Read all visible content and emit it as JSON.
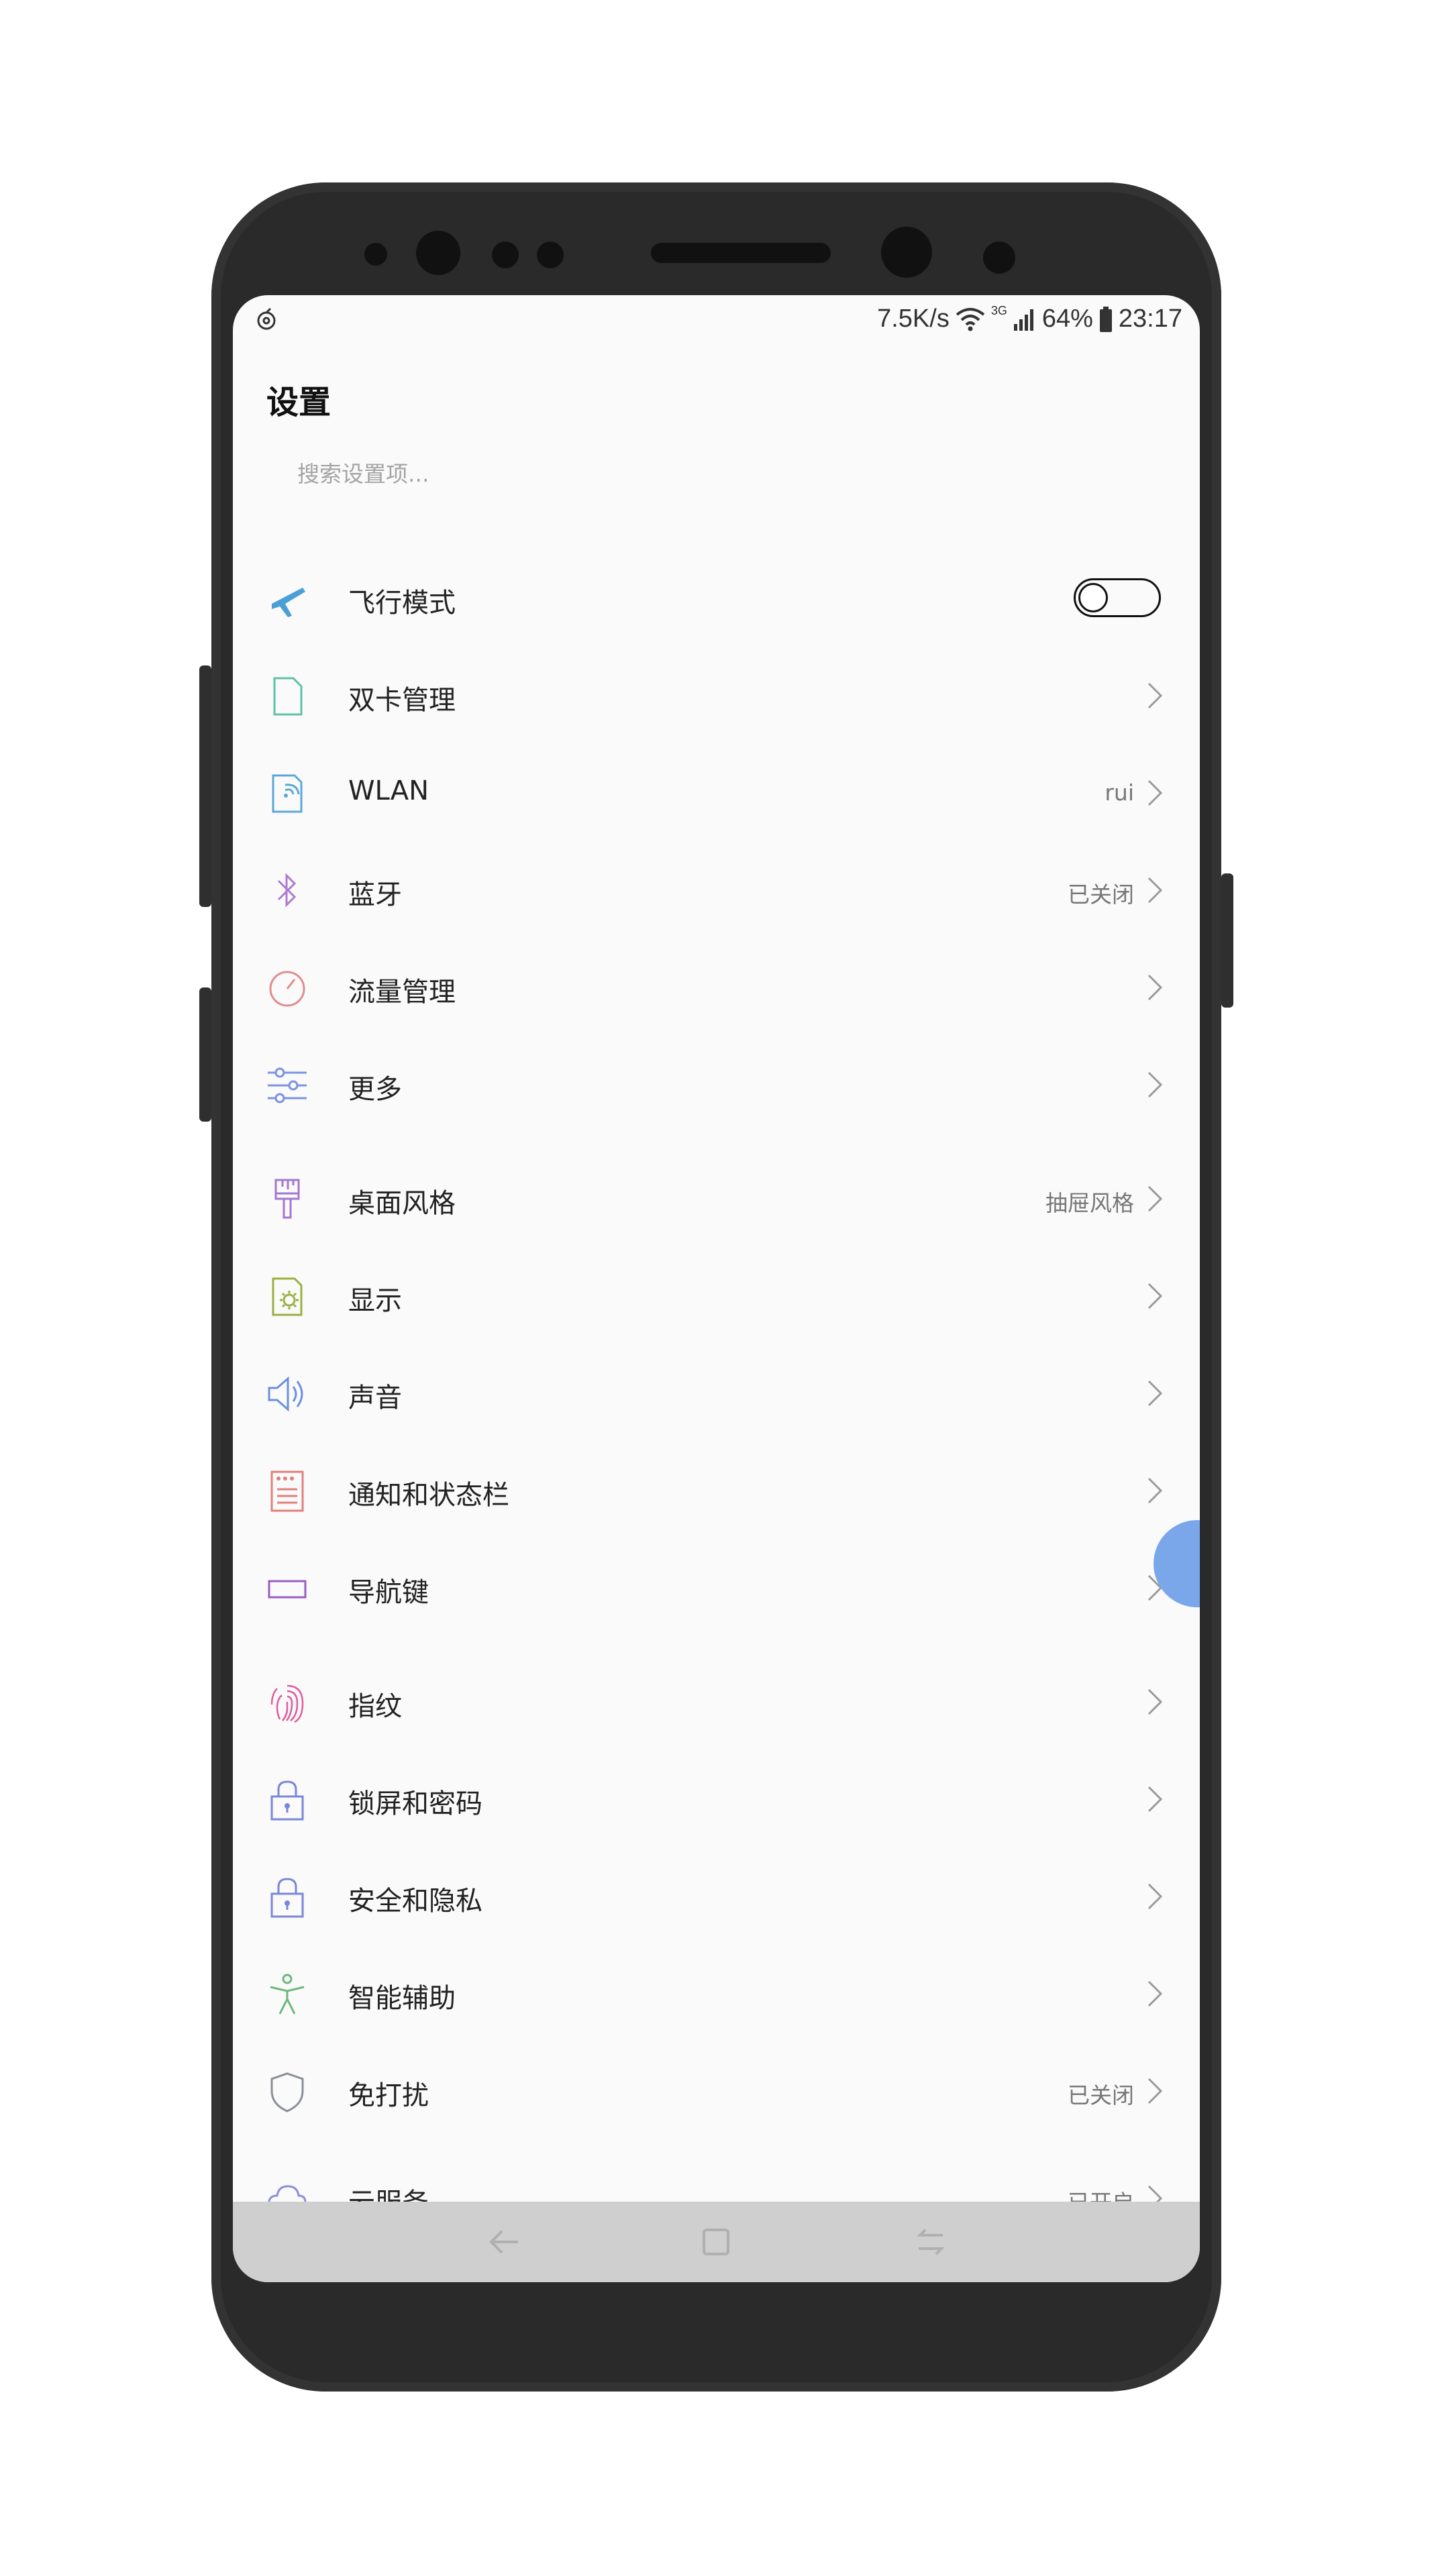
{
  "status_bar": {
    "net_speed": "7.5K/s",
    "network_type": "3G",
    "battery": "64%",
    "time": "23:17"
  },
  "header": {
    "title": "设置"
  },
  "search": {
    "placeholder": "搜索设置项..."
  },
  "rows": [
    {
      "label": "飞行模式",
      "value": "",
      "icon": "airplane-icon",
      "color": "#4a9fd8",
      "toggle": true,
      "toggle_on": false
    },
    {
      "label": "双卡管理",
      "value": "",
      "icon": "sim-card-icon",
      "color": "#5cc3a8"
    },
    {
      "label": "WLAN",
      "value": "rui",
      "icon": "wlan-icon",
      "color": "#5aa8d8"
    },
    {
      "label": "蓝牙",
      "value": "已关闭",
      "icon": "bluetooth-icon",
      "color": "#b07ad0"
    },
    {
      "label": "流量管理",
      "value": "",
      "icon": "data-usage-icon",
      "color": "#e08c8c"
    },
    {
      "label": "更多",
      "value": "",
      "icon": "sliders-icon",
      "color": "#7b93e0"
    },
    {
      "label": "桌面风格",
      "value": "抽屉风格",
      "icon": "brush-icon",
      "color": "#a477d0"
    },
    {
      "label": "显示",
      "value": "",
      "icon": "display-icon",
      "color": "#9ab040"
    },
    {
      "label": "声音",
      "value": "",
      "icon": "speaker-icon",
      "color": "#6b8fe0"
    },
    {
      "label": "通知和状态栏",
      "value": "",
      "icon": "notification-icon",
      "color": "#e0807a"
    },
    {
      "label": "导航键",
      "value": "",
      "icon": "navigation-key-icon",
      "color": "#9a5cc6"
    },
    {
      "label": "指纹",
      "value": "",
      "icon": "fingerprint-icon",
      "color": "#e05aa0"
    },
    {
      "label": "锁屏和密码",
      "value": "",
      "icon": "lock-icon",
      "color": "#7a86d8"
    },
    {
      "label": "安全和隐私",
      "value": "",
      "icon": "security-lock-icon",
      "color": "#7a86d8"
    },
    {
      "label": "智能辅助",
      "value": "",
      "icon": "accessibility-icon",
      "color": "#6cb87a"
    },
    {
      "label": "免打扰",
      "value": "已关闭",
      "icon": "shield-icon",
      "color": "#8a8f96"
    },
    {
      "label": "云服务",
      "value": "已开启",
      "icon": "cloud-icon",
      "color": "#8a8fd8"
    }
  ],
  "nav_bar": {
    "back": "back-icon",
    "home": "home-icon",
    "recents": "recents-icon"
  }
}
